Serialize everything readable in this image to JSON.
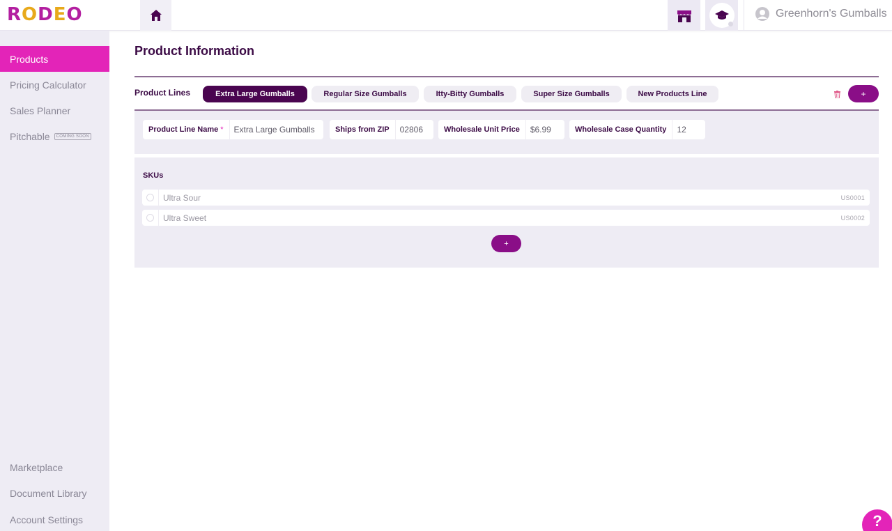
{
  "brand": {
    "logo_text": "RODEO",
    "accent": "#e324b8",
    "dark": "#4a0550",
    "button": "#8a0e87"
  },
  "header": {
    "home_icon": "house-icon",
    "store_icon": "storefront-icon",
    "education_icon": "graduation-cap-icon",
    "user_name": "Greenhorn's Gumballs"
  },
  "sidebar": {
    "items": [
      {
        "label": "Products",
        "active": true
      },
      {
        "label": "Pricing Calculator",
        "active": false
      },
      {
        "label": "Sales Planner",
        "active": false
      },
      {
        "label": "Pitchable",
        "active": false,
        "badge": "COMING SOON"
      }
    ],
    "bottom_items": [
      {
        "label": "Marketplace"
      },
      {
        "label": "Document Library"
      },
      {
        "label": "Account Settings"
      }
    ]
  },
  "main": {
    "title": "Product Information",
    "product_lines_label": "Product Lines",
    "product_lines": [
      {
        "label": "Extra Large Gumballs",
        "active": true
      },
      {
        "label": "Regular Size Gumballs",
        "active": false
      },
      {
        "label": "Itty-Bitty Gumballs",
        "active": false
      },
      {
        "label": "Super Size Gumballs",
        "active": false
      },
      {
        "label": "New Products Line",
        "active": false
      }
    ],
    "add_line_label": "+",
    "fields": {
      "name_label": "Product Line Name",
      "name_required": "*",
      "name_value": "Extra Large Gumballs",
      "zip_label": "Ships from ZIP",
      "zip_value": "02806",
      "price_label": "Wholesale Unit Price",
      "price_value": "$6.99",
      "case_label": "Wholesale Case Quantity",
      "case_value": "12"
    },
    "skus_title": "SKUs",
    "skus": [
      {
        "name": "Ultra Sour",
        "code": "US0001"
      },
      {
        "name": "Ultra Sweet",
        "code": "US0002"
      }
    ],
    "add_sku_label": "+"
  },
  "help": {
    "label": "?"
  }
}
